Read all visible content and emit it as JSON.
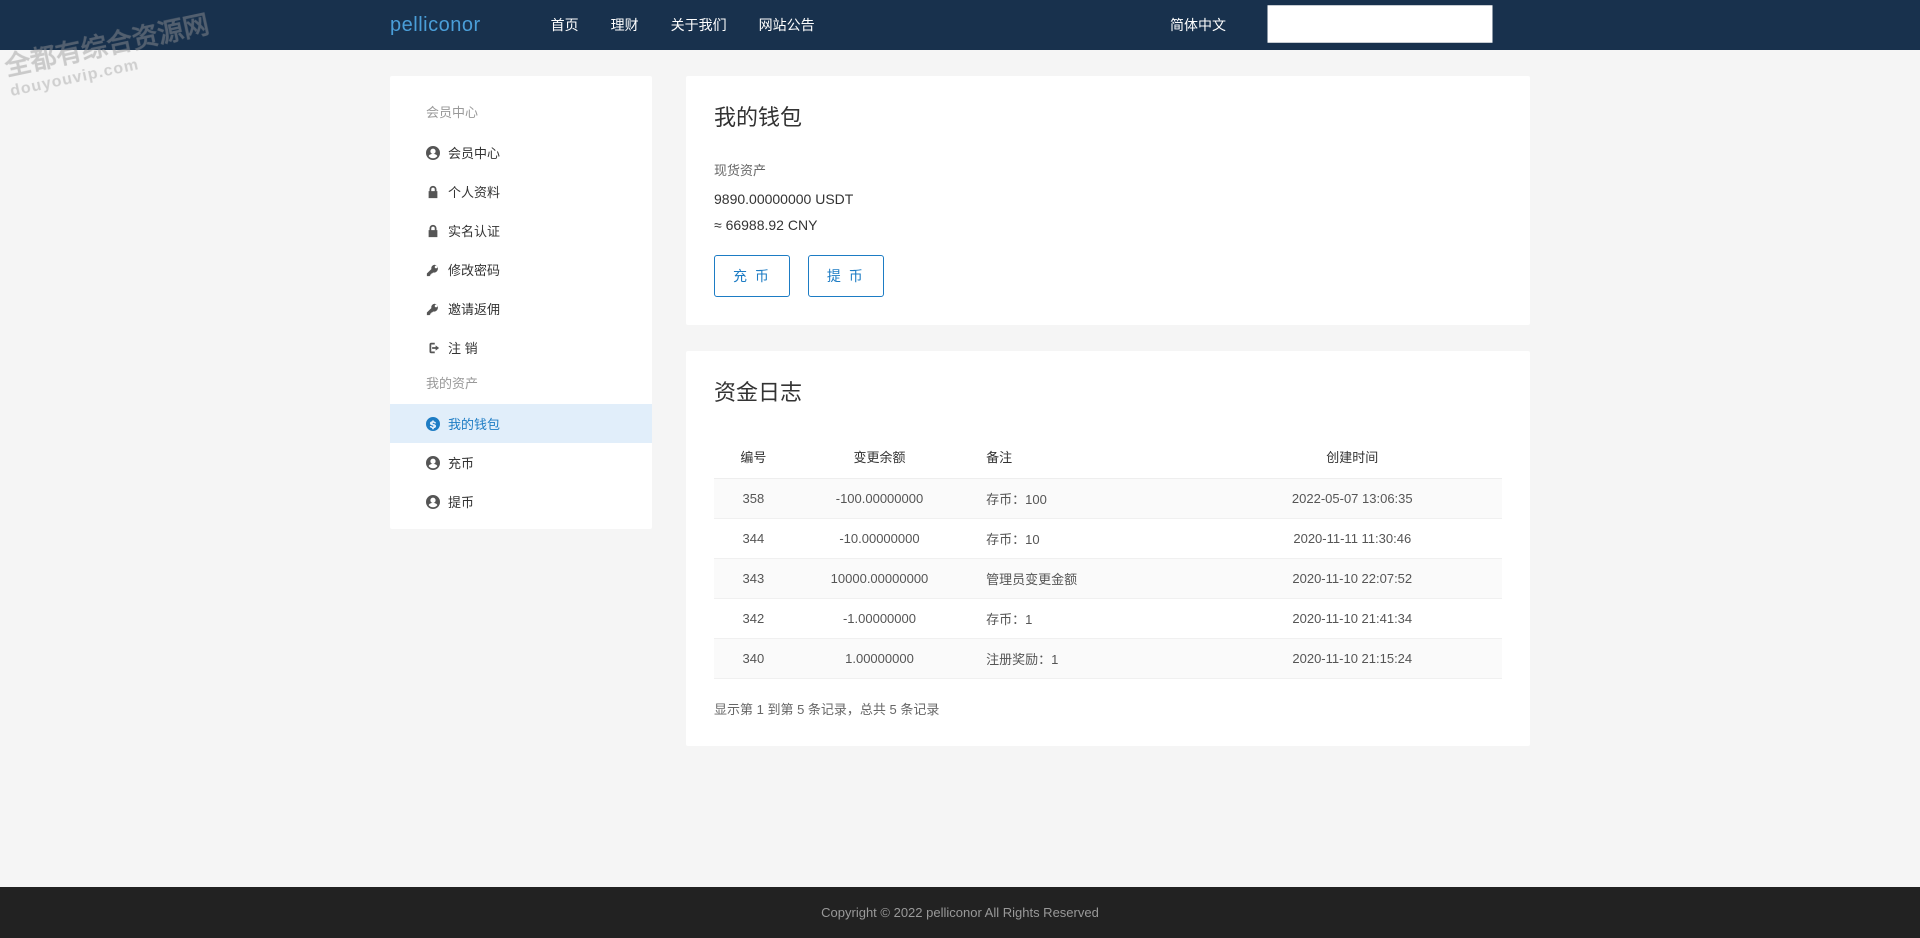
{
  "header": {
    "logo": "pelliconor",
    "nav": [
      "首页",
      "理财",
      "关于我们",
      "网站公告"
    ],
    "lang": "简体中文"
  },
  "sidebar": {
    "section1_title": "会员中心",
    "section1_items": [
      {
        "label": "会员中心",
        "icon": "user-circle"
      },
      {
        "label": "个人资料",
        "icon": "lock"
      },
      {
        "label": "实名认证",
        "icon": "lock"
      },
      {
        "label": "修改密码",
        "icon": "key"
      },
      {
        "label": "邀请返佣",
        "icon": "key"
      },
      {
        "label": "注 销",
        "icon": "signout"
      }
    ],
    "section2_title": "我的资产",
    "section2_items": [
      {
        "label": "我的钱包",
        "icon": "wallet",
        "active": true
      },
      {
        "label": "充币",
        "icon": "user-circle"
      },
      {
        "label": "提币",
        "icon": "user-circle"
      }
    ]
  },
  "wallet": {
    "title": "我的钱包",
    "asset_label": "现货资产",
    "asset_value": "9890.00000000 USDT",
    "asset_cny": "≈ 66988.92 CNY",
    "btn_deposit": "充 币",
    "btn_withdraw": "提 币"
  },
  "log": {
    "title": "资金日志",
    "columns": {
      "id": "编号",
      "amount": "变更余额",
      "note": "备注",
      "time": "创建时间"
    },
    "rows": [
      {
        "id": "358",
        "amount": "-100.00000000",
        "note": "存币：100",
        "time": "2022-05-07 13:06:35"
      },
      {
        "id": "344",
        "amount": "-10.00000000",
        "note": "存币：10",
        "time": "2020-11-11 11:30:46"
      },
      {
        "id": "343",
        "amount": "10000.00000000",
        "note": "管理员变更金额",
        "time": "2020-11-10 22:07:52"
      },
      {
        "id": "342",
        "amount": "-1.00000000",
        "note": "存币：1",
        "time": "2020-11-10 21:41:34"
      },
      {
        "id": "340",
        "amount": "1.00000000",
        "note": "注册奖励：1",
        "time": "2020-11-10 21:15:24"
      }
    ],
    "pagination": "显示第 1 到第 5 条记录，总共 5 条记录"
  },
  "footer": "Copyright © 2022 pelliconor All Rights Reserved",
  "watermark": {
    "line1": "全都有综合资源网",
    "line2": "douyouvip.com"
  }
}
